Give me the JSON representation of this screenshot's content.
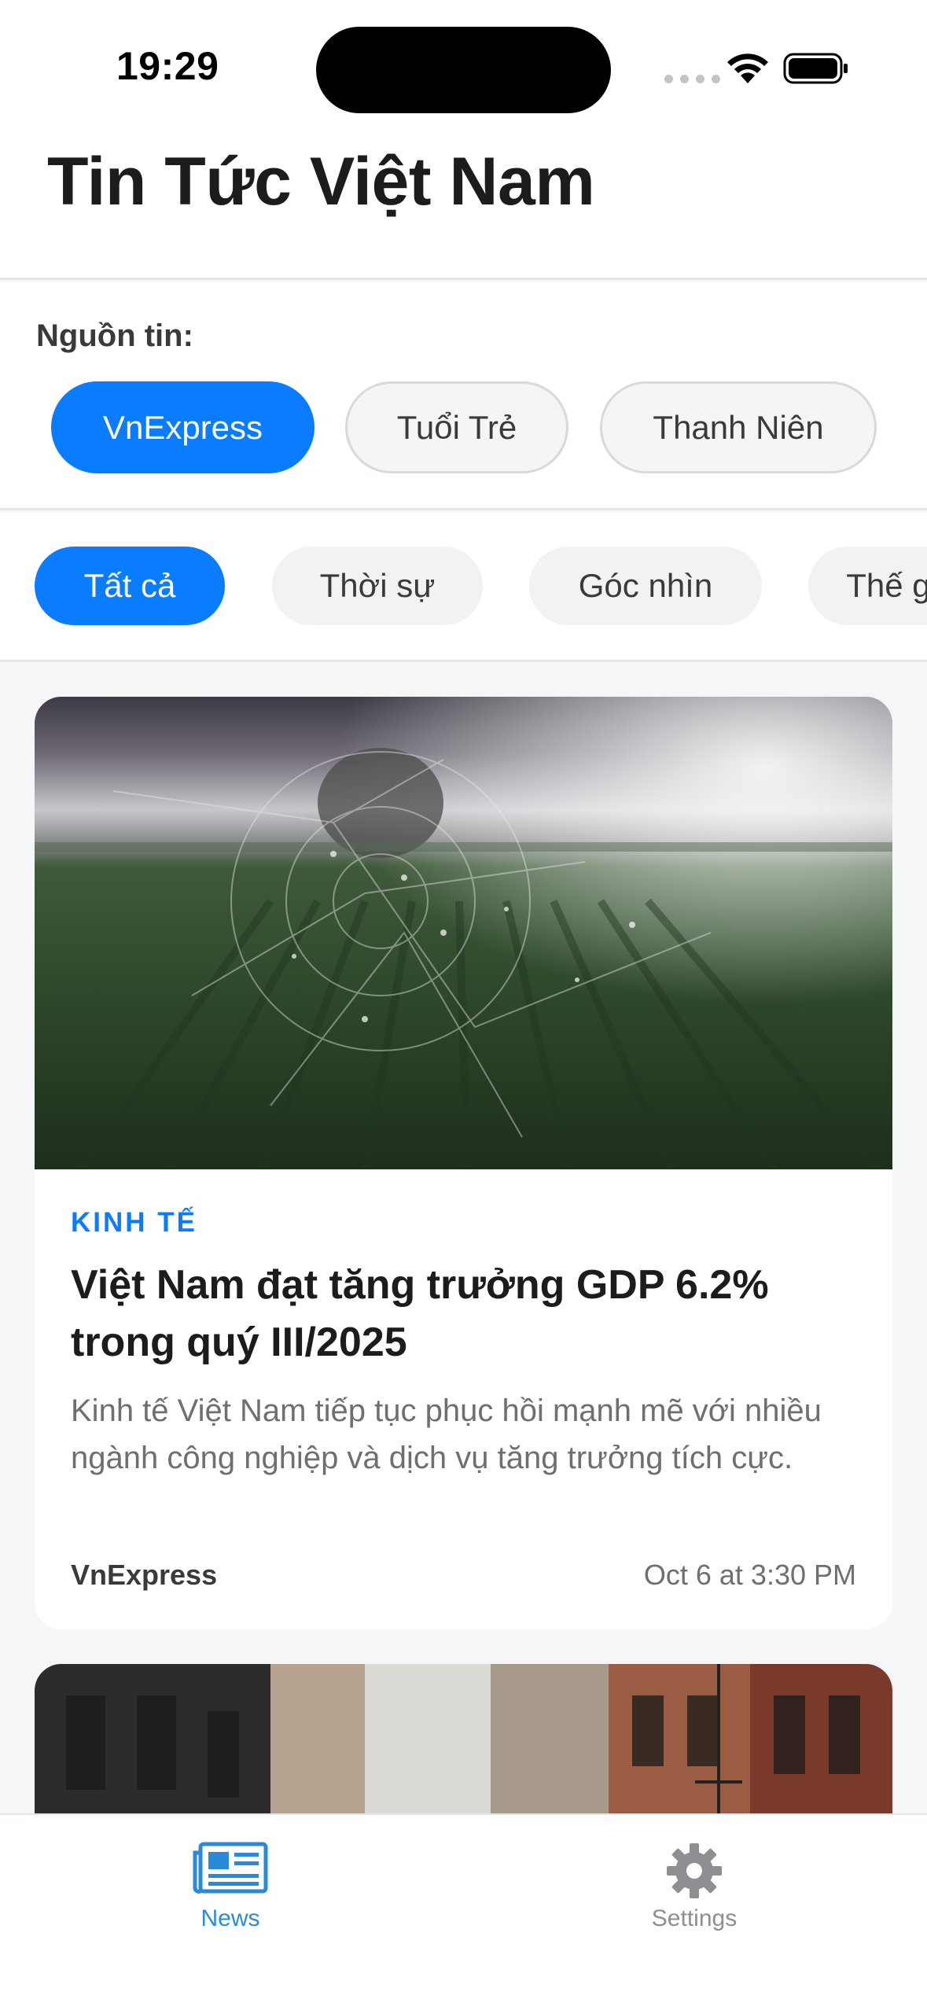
{
  "status_bar": {
    "time": "19:29"
  },
  "header": {
    "title": "Tin Tức Việt Nam"
  },
  "sources": {
    "label": "Nguồn tin:",
    "items": [
      "VnExpress",
      "Tuổi Trẻ",
      "Thanh Niên"
    ],
    "selected": "VnExpress"
  },
  "categories": {
    "items": [
      "Tất cả",
      "Thời sự",
      "Góc nhìn",
      "Thế giới"
    ],
    "selected": "Tất cả"
  },
  "articles": [
    {
      "category": "KINH TẾ",
      "title": "Việt Nam đạt tăng trưởng GDP 6.2% trong quý III/2025",
      "summary": "Kinh tế Việt Nam tiếp tục phục hồi mạnh mẽ với nhiều ngành công nghiệp và dịch vụ tăng trưởng tích cực.",
      "source": "VnExpress",
      "time": "Oct 6 at 3:30 PM"
    }
  ],
  "tab_bar": {
    "items": [
      {
        "label": "News",
        "icon": "newspaper-icon",
        "active": true
      },
      {
        "label": "Settings",
        "icon": "gear-icon",
        "active": false
      }
    ]
  },
  "colors": {
    "accent": "#0a7cff",
    "tab_active": "#2a8ad8",
    "tab_inactive": "#8e8e93"
  }
}
